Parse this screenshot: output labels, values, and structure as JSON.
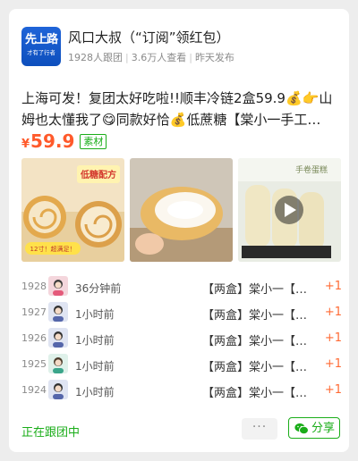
{
  "header": {
    "logo_line1": "先上路",
    "logo_line2": "才有了行者",
    "title": "风口大叔（“订阅”领红包）",
    "followers": "1928人跟团",
    "views": "3.6万人查看",
    "published": "昨天发布"
  },
  "post": {
    "description": "上海可发！复团太好吃啦!!顺丰冷链2盒59.9💰👉山姆也太懂我了😋同款好恰💰低蔗糖【棠小一手工…",
    "price_symbol": "¥",
    "price": "59.9",
    "tag": "素材"
  },
  "images": [
    {
      "name": "cake-roll-photo-1",
      "banner": "低糖配方",
      "badge": "12寸！超满足！"
    },
    {
      "name": "cake-roll-photo-2"
    },
    {
      "name": "cake-roll-video",
      "brand": "手卷蛋糕"
    }
  ],
  "records": [
    {
      "num": "1928",
      "time": "36分钟前",
      "product": "【两盒】棠小一【…",
      "plus": "+1"
    },
    {
      "num": "1927",
      "time": "1小时前",
      "product": "【两盒】棠小一【…",
      "plus": "+1"
    },
    {
      "num": "1926",
      "time": "1小时前",
      "product": "【两盒】棠小一【…",
      "plus": "+1"
    },
    {
      "num": "1925",
      "time": "1小时前",
      "product": "【两盒】棠小一【…",
      "plus": "+1"
    },
    {
      "num": "1924",
      "time": "1小时前",
      "product": "【两盒】棠小一【…",
      "plus": "+1"
    }
  ],
  "footer": {
    "status": "正在跟团中",
    "more": "···",
    "share": "分享"
  },
  "colors": {
    "accent_green": "#1aad19",
    "price_orange": "#ff5a2b",
    "plus_orange": "#ff6b35"
  }
}
